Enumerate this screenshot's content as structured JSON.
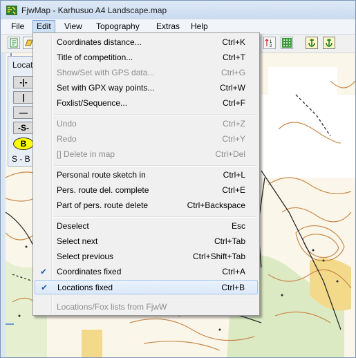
{
  "window": {
    "title": "FjwMap - Karhusuo A4 Landscape.map"
  },
  "menubar": {
    "items": [
      {
        "label": "File"
      },
      {
        "label": "Edit"
      },
      {
        "label": "View"
      },
      {
        "label": "Topography"
      },
      {
        "label": "Extras"
      },
      {
        "label": "Help"
      }
    ]
  },
  "panel": {
    "title": "Locat",
    "buttons": [
      "-|-",
      "|",
      "—",
      "-S-"
    ],
    "b_label": "B",
    "s_label": "S - B"
  },
  "edit_menu": {
    "items": [
      {
        "label": "Coordinates distance...",
        "shortcut": "Ctrl+K",
        "enabled": true
      },
      {
        "label": "Title of competition...",
        "shortcut": "Ctrl+T",
        "enabled": true
      },
      {
        "label": "Show/Set with GPS data...",
        "shortcut": "Ctrl+G",
        "enabled": false
      },
      {
        "label": "Set with GPX way points...",
        "shortcut": "Ctrl+W",
        "enabled": true
      },
      {
        "label": "Foxlist/Sequence...",
        "shortcut": "Ctrl+F",
        "enabled": true
      },
      {
        "label": "Undo",
        "shortcut": "Ctrl+Z",
        "enabled": false
      },
      {
        "label": "Redo",
        "shortcut": "Ctrl+Y",
        "enabled": false
      },
      {
        "label": "[] Delete in map",
        "shortcut": "Ctrl+Del",
        "enabled": false
      },
      {
        "label": "Personal route sketch in",
        "shortcut": "Ctrl+L",
        "enabled": true
      },
      {
        "label": "Pers. route del. complete",
        "shortcut": "Ctrl+E",
        "enabled": true
      },
      {
        "label": "Part of pers. route delete",
        "shortcut": "Ctrl+Backspace",
        "enabled": true
      },
      {
        "label": "Deselect",
        "shortcut": "Esc",
        "enabled": true
      },
      {
        "label": "Select next",
        "shortcut": "Ctrl+Tab",
        "enabled": true
      },
      {
        "label": "Select previous",
        "shortcut": "Ctrl+Shift+Tab",
        "enabled": true
      },
      {
        "label": "Coordinates fixed",
        "shortcut": "Ctrl+A",
        "enabled": true,
        "checked": true
      },
      {
        "label": "Locations fixed",
        "shortcut": "Ctrl+B",
        "enabled": true,
        "checked": true
      },
      {
        "label": "Locations/Fox lists from FjwW",
        "shortcut": "",
        "enabled": false
      }
    ],
    "check_glyph": "✔"
  },
  "colors": {
    "accent": "#cde0f5",
    "map_brown": "#c98a4b",
    "map_black": "#2a2a2a"
  }
}
